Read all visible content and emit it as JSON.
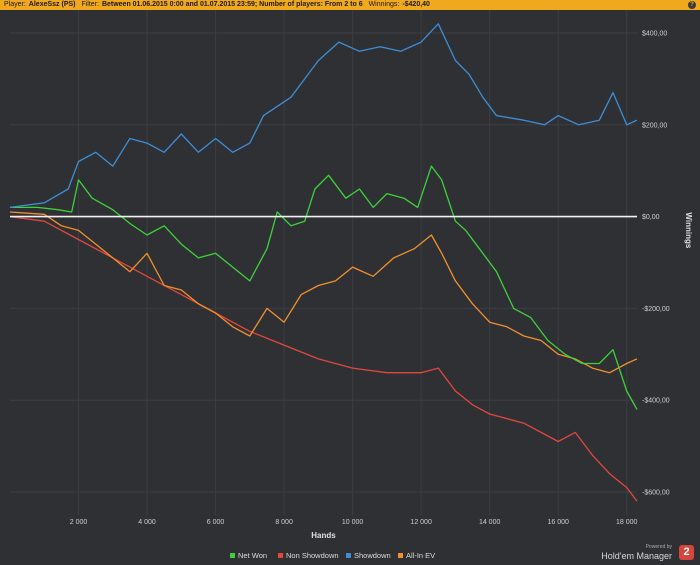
{
  "header": {
    "player_label": "Player:",
    "player": "AlexeSsz (PS)",
    "filter_label": "Filter:",
    "filter": "Between 01.06.2015 0:00 and 01.07.2015 23:59; Number of players: From 2 to 6",
    "winnings_label": "Winnings:",
    "winnings": "-$420,40"
  },
  "brand": {
    "powered": "Powered by",
    "name": "Hold'em Manager",
    "logo": "2"
  },
  "colors": {
    "net_won": "#3ed13a",
    "non_showdown": "#e0473e",
    "showdown": "#3d8ed6",
    "all_in_ev": "#f0902e",
    "zero_line": "#f2f2f2",
    "background": "#2f3034"
  },
  "chart_data": {
    "type": "line",
    "xlabel": "Hands",
    "ylabel": "Winnings",
    "xlim": [
      0,
      18300
    ],
    "ylim": [
      -650,
      450
    ],
    "x_ticks": [
      2000,
      4000,
      6000,
      8000,
      10000,
      12000,
      14000,
      16000,
      18000
    ],
    "x_tick_labels": [
      "2 000",
      "4 000",
      "6 000",
      "8 000",
      "10 000",
      "12 000",
      "14 000",
      "16 000",
      "18 000"
    ],
    "y_ticks": [
      400,
      200,
      0,
      -200,
      -400,
      -600
    ],
    "y_tick_labels": [
      "$400,00",
      "$200,00",
      "$0,00",
      "-$200,00",
      "-$400,00",
      "-$600,00"
    ],
    "grid": true,
    "legend_position": "bottom",
    "series": [
      {
        "name": "Net Won",
        "color": "#3ed13a",
        "x": [
          0,
          800,
          1400,
          1800,
          2000,
          2400,
          3000,
          3500,
          4000,
          4500,
          5000,
          5500,
          6000,
          6500,
          7000,
          7500,
          7800,
          8200,
          8600,
          8900,
          9300,
          9800,
          10200,
          10600,
          11000,
          11500,
          11900,
          12300,
          12600,
          13000,
          13300,
          13700,
          14200,
          14700,
          15200,
          15700,
          16200,
          16700,
          17200,
          17600,
          18000,
          18300
        ],
        "y": [
          20,
          20,
          15,
          10,
          80,
          40,
          15,
          -15,
          -40,
          -20,
          -60,
          -90,
          -80,
          -110,
          -140,
          -70,
          10,
          -20,
          -10,
          60,
          90,
          40,
          60,
          20,
          50,
          40,
          20,
          110,
          80,
          -10,
          -30,
          -70,
          -120,
          -200,
          -220,
          -270,
          -300,
          -320,
          -320,
          -290,
          -380,
          -420
        ]
      },
      {
        "name": "Non Showdown",
        "color": "#e0473e",
        "x": [
          0,
          1000,
          2000,
          3000,
          4000,
          5000,
          6000,
          7000,
          8000,
          9000,
          10000,
          11000,
          12000,
          12500,
          13000,
          13500,
          14000,
          15000,
          16000,
          16500,
          17000,
          17500,
          18000,
          18300
        ],
        "y": [
          0,
          -10,
          -50,
          -90,
          -130,
          -170,
          -210,
          -250,
          -280,
          -310,
          -330,
          -340,
          -340,
          -330,
          -380,
          -410,
          -430,
          -450,
          -490,
          -470,
          -520,
          -560,
          -590,
          -620
        ]
      },
      {
        "name": "Showdown",
        "color": "#3d8ed6",
        "x": [
          0,
          1000,
          1700,
          2000,
          2500,
          3000,
          3500,
          4000,
          4500,
          5000,
          5500,
          6000,
          6500,
          7000,
          7400,
          7800,
          8200,
          8600,
          9000,
          9600,
          10200,
          10800,
          11400,
          12000,
          12500,
          13000,
          13400,
          13800,
          14200,
          15000,
          15600,
          16000,
          16600,
          17200,
          17600,
          18000,
          18300
        ],
        "y": [
          20,
          30,
          60,
          120,
          140,
          110,
          170,
          160,
          140,
          180,
          140,
          170,
          140,
          160,
          220,
          240,
          260,
          300,
          340,
          380,
          360,
          370,
          360,
          380,
          420,
          340,
          310,
          260,
          220,
          210,
          200,
          220,
          200,
          210,
          270,
          200,
          210
        ]
      },
      {
        "name": "All-In EV",
        "color": "#f0902e",
        "x": [
          0,
          1000,
          1500,
          2000,
          2500,
          3000,
          3500,
          4000,
          4500,
          5000,
          5500,
          6000,
          6500,
          7000,
          7500,
          8000,
          8500,
          9000,
          9500,
          10000,
          10600,
          11200,
          11800,
          12300,
          12600,
          13000,
          13500,
          14000,
          14500,
          15000,
          15500,
          16000,
          16500,
          17000,
          17500,
          18000,
          18300
        ],
        "y": [
          10,
          5,
          -20,
          -30,
          -60,
          -90,
          -120,
          -80,
          -150,
          -160,
          -190,
          -210,
          -240,
          -260,
          -200,
          -230,
          -170,
          -150,
          -140,
          -110,
          -130,
          -90,
          -70,
          -40,
          -80,
          -140,
          -190,
          -230,
          -240,
          -260,
          -270,
          -300,
          -310,
          -330,
          -340,
          -320,
          -310
        ]
      }
    ]
  }
}
